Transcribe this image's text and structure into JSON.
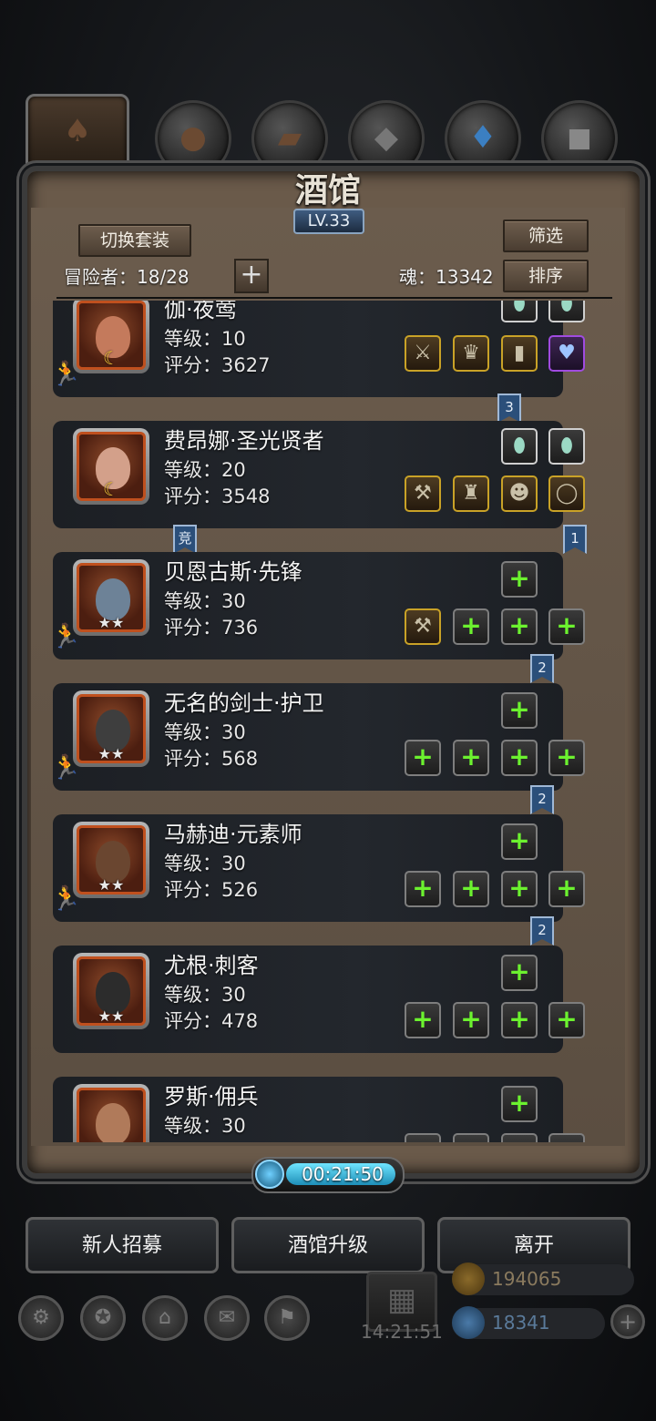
{
  "header": {
    "title": "酒馆",
    "level": "LV.33",
    "switch_outfit": "切换套装",
    "filter": "筛选",
    "sort": "排序",
    "adventurers_label": "冒险者：18/28",
    "soul_label": "魂：13342",
    "add_symbol": "+"
  },
  "heroes": [
    {
      "name": "伽·夜莺",
      "level": "等级：10",
      "score": "评分：3627",
      "badge": "☾",
      "flag": "3"
    },
    {
      "name": "费昂娜·圣光贤者",
      "level": "等级：20",
      "score": "评分：3548",
      "badge": "☾",
      "flag_left": "竞",
      "flag": "1"
    },
    {
      "name": "贝恩古斯·先锋",
      "level": "等级：30",
      "score": "评分：736",
      "badge": "★★",
      "flag": "2"
    },
    {
      "name": "无名的剑士·护卫",
      "level": "等级：30",
      "score": "评分：568",
      "badge": "★★",
      "flag": "2"
    },
    {
      "name": "马赫迪·元素师",
      "level": "等级：30",
      "score": "评分：526",
      "badge": "★★",
      "flag": "2"
    },
    {
      "name": "尤根·刺客",
      "level": "等级：30",
      "score": "评分：478",
      "badge": "★★"
    },
    {
      "name": "罗斯·佣兵",
      "level": "等级：30",
      "score": "",
      "badge": ""
    }
  ],
  "timer": "00:21:50",
  "actions": {
    "recruit": "新人招募",
    "upgrade": "酒馆升级",
    "leave": "离开"
  },
  "resources": {
    "gold": "194065",
    "gems": "18341",
    "gift_timer": "14:21:51"
  },
  "icons": {
    "slot_add": "+",
    "runner": "🏃"
  }
}
